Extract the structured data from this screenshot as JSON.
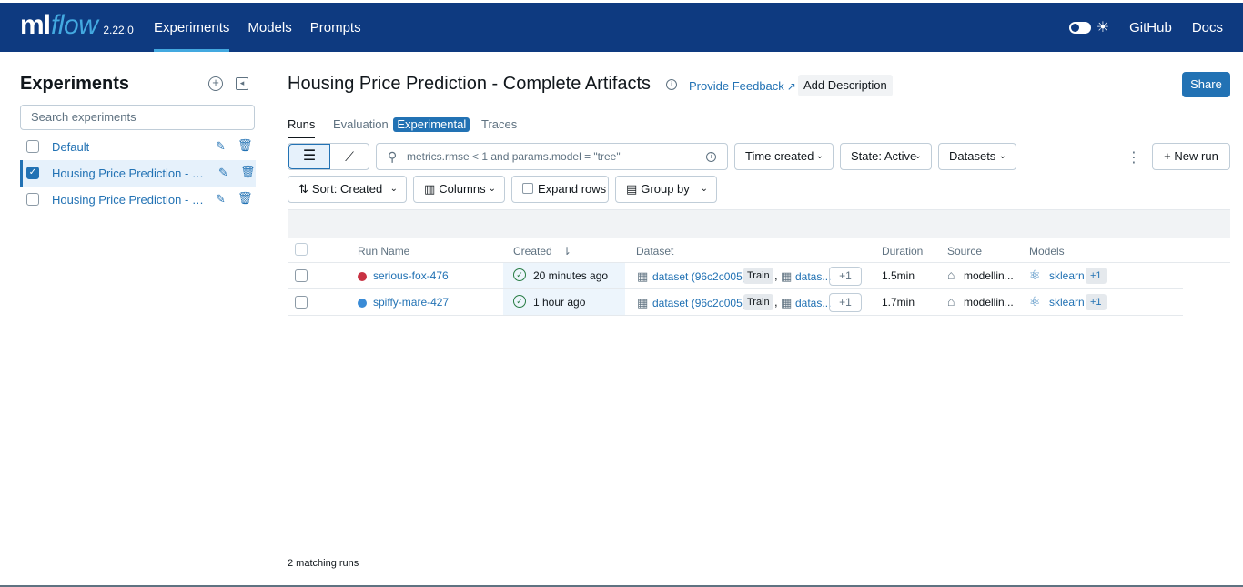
{
  "topbar": {
    "logo_ml": "ml",
    "logo_flow": "flow",
    "version": "2.22.0",
    "nav": [
      {
        "label": "Experiments",
        "active": true
      },
      {
        "label": "Models",
        "active": false
      },
      {
        "label": "Prompts",
        "active": false
      }
    ],
    "github": "GitHub",
    "docs": "Docs",
    "brand_color": "#0e3a80",
    "accent_color": "#43a9e0"
  },
  "sidebar": {
    "title": "Experiments",
    "search_placeholder": "Search experiments",
    "experiments": [
      {
        "name": "Default",
        "selected": false
      },
      {
        "name": "Housing Price Prediction - Complete Artifacts",
        "selected": true
      },
      {
        "name": "Housing Price Prediction - Basic",
        "selected": false
      }
    ]
  },
  "main": {
    "title": "Housing Price Prediction - Complete Artifacts",
    "feedback": "Provide Feedback",
    "add_description": "Add Description",
    "share": "Share",
    "tabs": {
      "runs": "Runs",
      "evaluation": "Evaluation",
      "experimental": "Experimental",
      "traces": "Traces"
    },
    "search_placeholder": "metrics.rmse < 1 and params.model = \"tree\"",
    "filters": {
      "time_created": "Time created",
      "state": "State: Active",
      "datasets": "Datasets",
      "new_run": "New run"
    },
    "controls": {
      "sort": "Sort: Created",
      "columns": "Columns",
      "expand_rows": "Expand rows",
      "group_by": "Group by"
    },
    "columns": {
      "run_name": "Run Name",
      "created": "Created",
      "dataset": "Dataset",
      "duration": "Duration",
      "source": "Source",
      "models": "Models"
    },
    "runs": [
      {
        "name": "serious-fox-476",
        "color": "#c83243",
        "created": "20 minutes ago",
        "dataset": "dataset (96c2c005)",
        "dataset_tag": "Train",
        "comma": ",",
        "dataset2": "datas...",
        "more_datasets": "+1",
        "duration": "1.5min",
        "source": "modellin...",
        "model": "sklearn",
        "more_models": "+1"
      },
      {
        "name": "spiffy-mare-427",
        "color": "#3a8bd6",
        "created": "1 hour ago",
        "dataset": "dataset (96c2c005)",
        "dataset_tag": "Train",
        "comma": ",",
        "dataset2": "datas...",
        "more_datasets": "+1",
        "duration": "1.7min",
        "source": "modellin...",
        "model": "sklearn",
        "more_models": "+1"
      }
    ],
    "footer": "2 matching runs"
  }
}
